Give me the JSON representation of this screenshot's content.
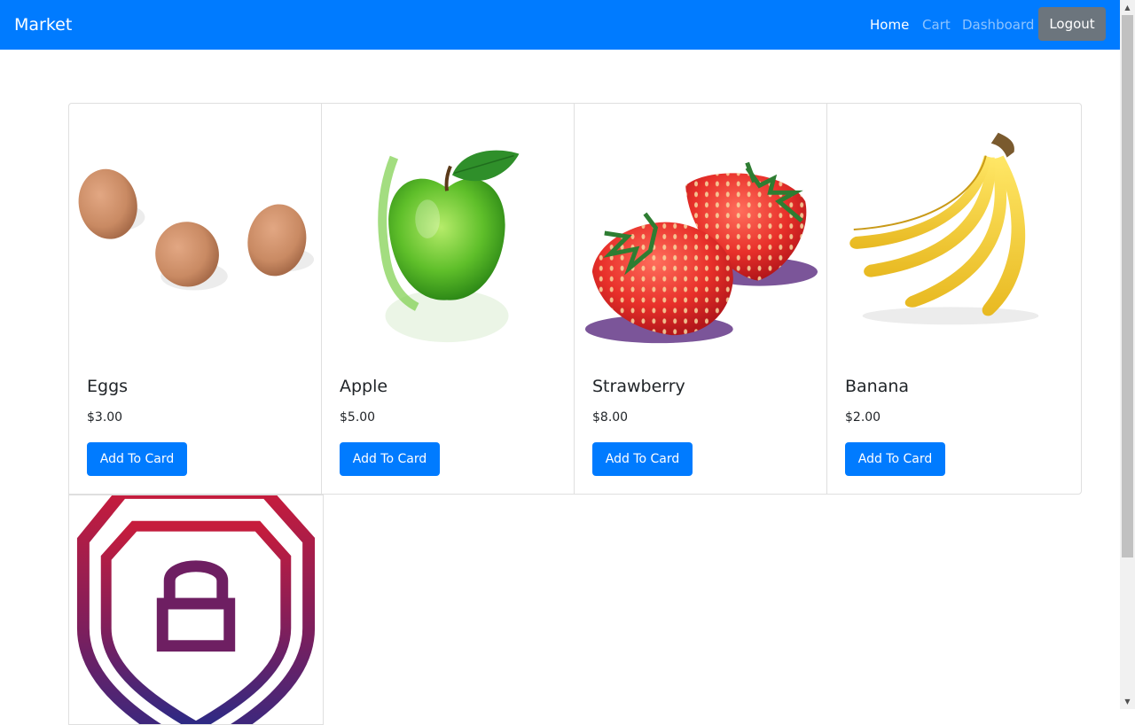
{
  "navbar": {
    "brand": "Market",
    "links": [
      "Home",
      "Cart",
      "Dashboard"
    ],
    "logout_label": "Logout",
    "background": "#007bff"
  },
  "products": [
    {
      "name": "Eggs",
      "price": "$3.00",
      "button_label": "Add To Card",
      "image": "eggs-image"
    },
    {
      "name": "Apple",
      "price": "$5.00",
      "button_label": "Add To Card",
      "image": "green-apple-image"
    },
    {
      "name": "Strawberry",
      "price": "$8.00",
      "button_label": "Add To Card",
      "image": "strawberries-image"
    },
    {
      "name": "Banana",
      "price": "$2.00",
      "button_label": "Add To Card",
      "image": "bananas-image"
    },
    {
      "image": "shield-lock-image"
    }
  ],
  "colors": {
    "primary": "#007bff",
    "secondary": "#6c757d"
  }
}
